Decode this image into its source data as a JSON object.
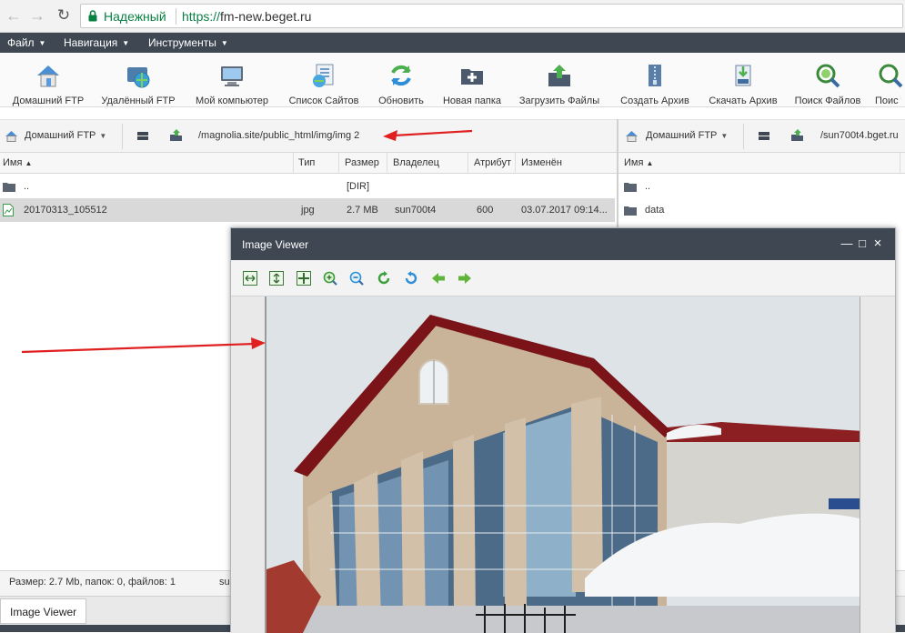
{
  "browser": {
    "security_label": "Надежный",
    "url_scheme": "https://",
    "url_host": "fm-new.beget.ru"
  },
  "menu": [
    {
      "label": "Файл"
    },
    {
      "label": "Навигация"
    },
    {
      "label": "Инструменты"
    }
  ],
  "toolbar": [
    {
      "label": "Домашний FTP",
      "icon": "home-icon"
    },
    {
      "label": "Удалённый FTP",
      "icon": "remote-ftp-icon"
    },
    {
      "label": "Мой компьютер",
      "icon": "computer-icon"
    },
    {
      "label": "Список Сайтов",
      "icon": "site-list-icon"
    },
    {
      "label": "Обновить",
      "icon": "refresh-icon"
    },
    {
      "label": "Новая папка",
      "icon": "new-folder-icon"
    },
    {
      "label": "Загрузить Файлы",
      "icon": "upload-icon"
    },
    {
      "label": "Создать Архив",
      "icon": "archive-icon"
    },
    {
      "label": "Скачать Архив",
      "icon": "download-archive-icon"
    },
    {
      "label": "Поиск Файлов",
      "icon": "search-files-icon"
    },
    {
      "label": "Поис",
      "icon": "search-text-icon"
    }
  ],
  "left_pane": {
    "location": "Домашний FTP",
    "path": "/magnolia.site/public_html/img/img 2",
    "columns": [
      "Имя",
      "Тип",
      "Размер",
      "Владелец",
      "Атрибут",
      "Изменён"
    ],
    "rows": [
      {
        "name": "..",
        "type": "",
        "size": "[DIR]",
        "owner": "",
        "attr": "",
        "modified": ""
      },
      {
        "name": "20170313_105512",
        "type": "jpg",
        "size": "2.7 MB",
        "owner": "sun700t4",
        "attr": "600",
        "modified": "03.07.2017 09:14..."
      }
    ]
  },
  "right_pane": {
    "location": "Домашний FTP",
    "path": "/sun700t4.bget.ru",
    "columns": [
      "Имя"
    ],
    "rows": [
      {
        "name": ".."
      },
      {
        "name": "data"
      }
    ]
  },
  "status": {
    "left": "Размер: 2.7 Mb, папок: 0, файлов: 1",
    "right": "su"
  },
  "taskbar": {
    "item": "Image Viewer"
  },
  "viewer": {
    "title": "Image Viewer",
    "tools": [
      "fit-width-icon",
      "fit-height-icon",
      "actual-size-icon",
      "zoom-in-icon",
      "zoom-out-icon",
      "rotate-left-icon",
      "rotate-right-icon",
      "previous-icon",
      "next-icon"
    ]
  },
  "colors": {
    "header_dark": "#3e4752",
    "annotation_arrow": "#e02020",
    "secure_green": "#0b8043"
  }
}
